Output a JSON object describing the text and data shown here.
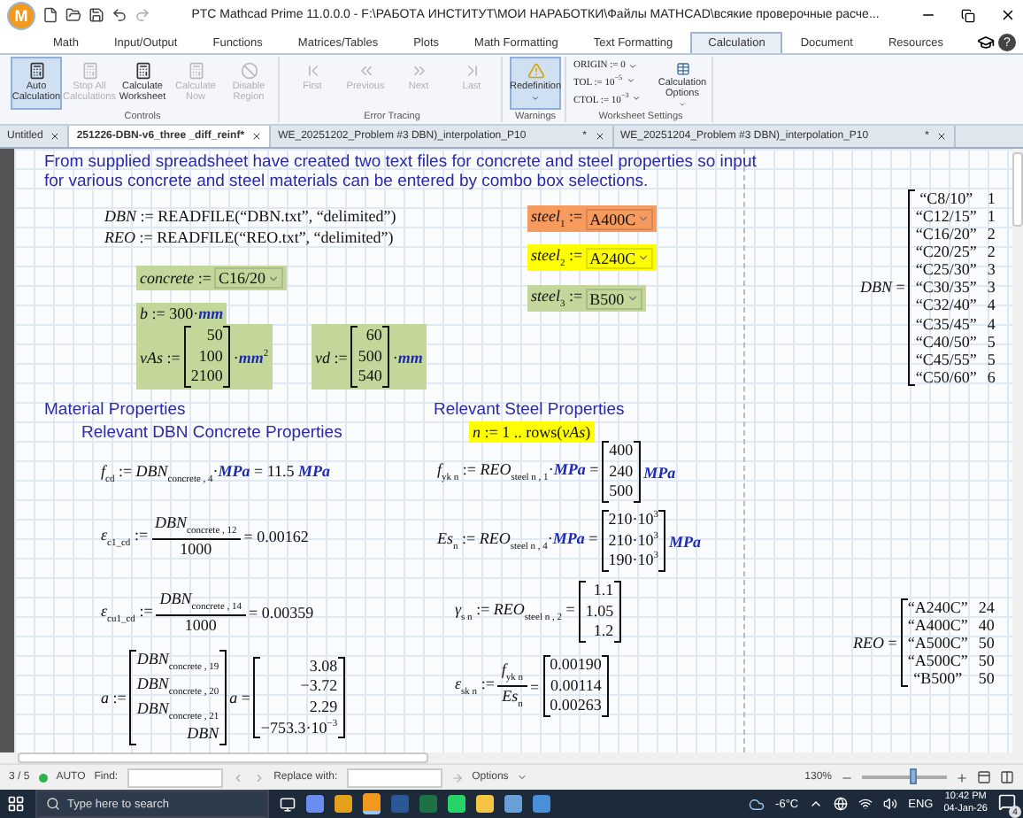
{
  "title_bar": {
    "app_logo": "M",
    "title": "PTC Mathcad Prime 11.0.0.0 - F:\\РАБОТА ИНСТИТУТ\\МОИ НАРАБОТКИ\\Файлы MATHCAD\\всякие проверочные расче..."
  },
  "ribbon_tabs": [
    {
      "label": "Math",
      "selected": false
    },
    {
      "label": "Input/Output",
      "selected": false
    },
    {
      "label": "Functions",
      "selected": false
    },
    {
      "label": "Matrices/Tables",
      "selected": false
    },
    {
      "label": "Plots",
      "selected": false
    },
    {
      "label": "Math Formatting",
      "selected": false
    },
    {
      "label": "Text Formatting",
      "selected": false
    },
    {
      "label": "Calculation",
      "selected": true
    },
    {
      "label": "Document",
      "selected": false
    },
    {
      "label": "Resources",
      "selected": false
    }
  ],
  "help": "?",
  "ribbon": {
    "groups": [
      {
        "label": "Controls",
        "buttons": [
          {
            "label": "Auto Calculation",
            "pressed": true,
            "disabled": false,
            "dropdown": false
          },
          {
            "label": "Stop All Calculations",
            "pressed": false,
            "disabled": true,
            "dropdown": false
          },
          {
            "label": "Calculate Worksheet",
            "pressed": false,
            "disabled": false,
            "dropdown": false
          },
          {
            "label": "Calculate Now",
            "pressed": false,
            "disabled": true,
            "dropdown": false
          },
          {
            "label": "Disable Region",
            "pressed": false,
            "disabled": true,
            "dropdown": false
          }
        ]
      },
      {
        "label": "Error Tracing",
        "buttons": [
          {
            "label": "First",
            "pressed": false,
            "disabled": true,
            "dropdown": false
          },
          {
            "label": "Previous",
            "pressed": false,
            "disabled": true,
            "dropdown": false
          },
          {
            "label": "Next",
            "pressed": false,
            "disabled": true,
            "dropdown": false
          },
          {
            "label": "Last",
            "pressed": false,
            "disabled": true,
            "dropdown": false
          }
        ]
      },
      {
        "label": "Warnings",
        "buttons": [
          {
            "label": "Redefinition",
            "pressed": true,
            "disabled": false,
            "dropdown": true
          }
        ]
      },
      {
        "label": "Worksheet Settings",
        "settings": [
          "ORIGIN := 0",
          "TOL := 10$^{−5}$",
          "CTOL := 10$^{−3}$"
        ],
        "buttons": [
          {
            "label": "Calculation Options",
            "pressed": false,
            "disabled": false,
            "dropdown": true
          }
        ]
      }
    ]
  },
  "documents": [
    {
      "label": "Untitled",
      "selected": false
    },
    {
      "label": "251226-DBN-v6_three _diff_reinf*",
      "selected": true
    },
    {
      "label": "WE_20251202_Problem #3 DBN)_interpolation_P10",
      "marker": "*",
      "selected": false
    },
    {
      "label": "WE_20251204_Problem #3 DBN)_interpolation_P10",
      "marker": "*",
      "selected": false
    }
  ],
  "worksheet": {
    "regions": [
      {
        "kind": "note",
        "text": "From supplied spreadsheet have created two text files for concrete and steel properties so input for various concrete and steel materials can be entered by combo box selections."
      },
      {
        "kind": "math",
        "parts": [
          {
            "kind": "text",
            "text": "*DBN* := READFILE(“DBN.txt”, “delimited”)"
          }
        ]
      },
      {
        "kind": "math",
        "parts": [
          {
            "kind": "text",
            "text": "*REO* := READFILE(“REO.txt”, “delimited”)"
          }
        ]
      },
      {
        "kind": "math",
        "color": "#c4d79b",
        "parts": [
          {
            "kind": "text",
            "text": "*concrete* :="
          },
          {
            "kind": "combo",
            "text": "C16/20"
          }
        ]
      },
      {
        "kind": "math",
        "color": "#c4d79b",
        "parts": [
          {
            "kind": "text",
            "text": "*b* := 300·**mm**"
          }
        ]
      },
      {
        "kind": "math",
        "color": "#c4d79b",
        "parts": [
          {
            "kind": "text",
            "text": "*vAs* :="
          },
          {
            "kind": "matrix",
            "rows": [
              [
                "50"
              ],
              [
                "100"
              ],
              [
                "2100"
              ]
            ]
          },
          {
            "kind": "text",
            "text": "·**mm**$^{2}$"
          }
        ]
      },
      {
        "kind": "math",
        "color": "#c4d79b",
        "parts": [
          {
            "kind": "text",
            "text": "*vd* :="
          },
          {
            "kind": "matrix",
            "rows": [
              [
                "60"
              ],
              [
                "500"
              ],
              [
                "540"
              ]
            ]
          },
          {
            "kind": "text",
            "text": "·**mm**"
          }
        ]
      },
      {
        "kind": "math",
        "color": "#f79a5e",
        "parts": [
          {
            "kind": "text",
            "text": "*steel*$_{1}$ :="
          },
          {
            "kind": "combo",
            "text": "A400C"
          }
        ]
      },
      {
        "kind": "math",
        "color": "#ffff00",
        "parts": [
          {
            "kind": "text",
            "text": "*steel*$_{2}$ :="
          },
          {
            "kind": "combo",
            "text": "A240C"
          }
        ]
      },
      {
        "kind": "math",
        "color": "#c4d79b",
        "parts": [
          {
            "kind": "text",
            "text": "*steel*$_{3}$ :="
          },
          {
            "kind": "combo",
            "text": "B500"
          }
        ]
      },
      {
        "kind": "math",
        "parts": [
          {
            "kind": "text",
            "text": "*DBN* ="
          },
          {
            "kind": "matrix",
            "open": true,
            "rows": [
              [
                "“C8/10”",
                "1"
              ],
              [
                "“C12/15”",
                "1"
              ],
              [
                "“C16/20”",
                "2"
              ],
              [
                "“C20/25”",
                "2"
              ],
              [
                "“C25/30”",
                "3"
              ],
              [
                "“C30/35”",
                "3"
              ],
              [
                "“C32/40”",
                "4"
              ],
              [
                "“C35/45”",
                "4"
              ],
              [
                "“C40/50”",
                "5"
              ],
              [
                "“C45/55”",
                "5"
              ],
              [
                "“C50/60”",
                "6"
              ]
            ]
          }
        ]
      },
      {
        "kind": "note",
        "text": "Material Properties"
      },
      {
        "kind": "note",
        "text": "Relevant DBN Concrete Properties"
      },
      {
        "kind": "note",
        "text": "Relevant Steel Properties"
      },
      {
        "kind": "math",
        "color": "#ffff00",
        "parts": [
          {
            "kind": "text",
            "text": "*n* := 1 .. rows(*vAs*)"
          }
        ]
      },
      {
        "kind": "math",
        "parts": [
          {
            "kind": "text",
            "text": "*f*$_{cd}$ := *DBN*$_{concrete , 4}$·**MPa** = 11.5 **MPa**"
          }
        ]
      },
      {
        "kind": "math",
        "parts": [
          {
            "kind": "text",
            "text": "*ε*$_{c1_cd}$ :="
          },
          {
            "kind": "fraction",
            "num": "*DBN*$_{concrete , 12}$",
            "den": "1000"
          },
          {
            "kind": "text",
            "text": "= 0.00162"
          }
        ]
      },
      {
        "kind": "math",
        "parts": [
          {
            "kind": "text",
            "text": "*ε*$_{cu1_cd}$ :="
          },
          {
            "kind": "fraction",
            "num": "*DBN*$_{concrete , 14}$",
            "den": "1000"
          },
          {
            "kind": "text",
            "text": "= 0.00359"
          }
        ]
      },
      {
        "kind": "math",
        "parts": [
          {
            "kind": "text",
            "text": "*a* :="
          },
          {
            "kind": "matrix",
            "rows": [
              [
                "*DBN*$_{concrete , 19}$"
              ],
              [
                "*DBN*$_{concrete , 20}$"
              ],
              [
                "*DBN*$_{concrete , 21}$"
              ],
              [
                "*DBN*"
              ]
            ]
          },
          {
            "kind": "text",
            "text": "*a* ="
          },
          {
            "kind": "matrix",
            "rows": [
              [
                "3.08"
              ],
              [
                "−3.72"
              ],
              [
                "2.29"
              ],
              [
                "−753.3·10$^{−3}$"
              ]
            ]
          }
        ]
      },
      {
        "kind": "math",
        "parts": [
          {
            "kind": "text",
            "text": "*f*$_{yk n}$ := *REO*$_{steel n , 1}$·**MPa** ="
          },
          {
            "kind": "matrix",
            "rows": [
              [
                "400"
              ],
              [
                "240"
              ],
              [
                "500"
              ]
            ]
          },
          {
            "kind": "text",
            "text": "**MPa**"
          }
        ]
      },
      {
        "kind": "math",
        "parts": [
          {
            "kind": "text",
            "text": "*Es*$_{n}$ := *REO*$_{steel n , 4}$·**MPa** ="
          },
          {
            "kind": "matrix",
            "rows": [
              [
                "210·10$^{3}$"
              ],
              [
                "210·10$^{3}$"
              ],
              [
                "190·10$^{3}$"
              ]
            ]
          },
          {
            "kind": "text",
            "text": "**MPa**"
          }
        ]
      },
      {
        "kind": "math",
        "parts": [
          {
            "kind": "text",
            "text": "*γ*$_{s n}$ := *REO*$_{steel n , 2}$ ="
          },
          {
            "kind": "matrix",
            "rows": [
              [
                "1.1"
              ],
              [
                "1.05"
              ],
              [
                "1.2"
              ]
            ]
          }
        ]
      },
      {
        "kind": "math",
        "parts": [
          {
            "kind": "text",
            "text": "*ε*$_{sk n}$ :="
          },
          {
            "kind": "fraction",
            "num": "*f*$_{yk n}$",
            "den": "*Es*$_{n}$"
          },
          {
            "kind": "text",
            "text": "="
          },
          {
            "kind": "matrix",
            "rows": [
              [
                "0.00190"
              ],
              [
                "0.00114"
              ],
              [
                "0.00263"
              ]
            ]
          }
        ]
      },
      {
        "kind": "math",
        "parts": [
          {
            "kind": "text",
            "text": "*REO* ="
          },
          {
            "kind": "matrix",
            "open": true,
            "rows": [
              [
                "“A240C”",
                "24"
              ],
              [
                "“A400C”",
                "40"
              ],
              [
                "“A500C”",
                "50"
              ],
              [
                "“A500C”",
                "50"
              ],
              [
                "“B500”",
                "50"
              ]
            ]
          }
        ]
      }
    ]
  },
  "status_bar": {
    "page": "3 / 5",
    "mode": "AUTO",
    "find_label": "Find:",
    "replace_label": "Replace with:",
    "options": "Options",
    "zoom": "130%",
    "zoom_slider": {
      "level": 0.6
    }
  },
  "taskbar": {
    "search_placeholder": "Type here to search",
    "weather": "-6°C",
    "language": "ENG",
    "time": "10:42 PM",
    "date": "04-Jan-26",
    "notifications": "4"
  }
}
